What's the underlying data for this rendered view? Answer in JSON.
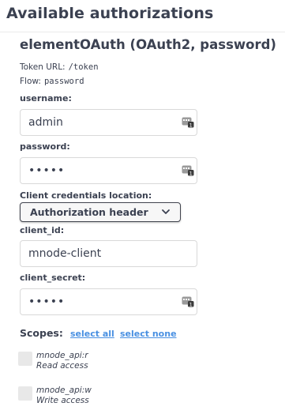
{
  "modal": {
    "title": "Available authorizations"
  },
  "auth": {
    "title": "elementOAuth (OAuth2, password)",
    "token_url_label": "Token URL:",
    "token_url_value": "/token",
    "flow_label": "Flow:",
    "flow_value": "password"
  },
  "fields": {
    "username": {
      "label": "username:",
      "value": "admin"
    },
    "password": {
      "label": "password:",
      "value": "•••••"
    },
    "client_credentials_location": {
      "label": "Client credentials location:",
      "selected": "Authorization header"
    },
    "client_id": {
      "label": "client_id:",
      "value": "mnode-client"
    },
    "client_secret": {
      "label": "client_secret:",
      "value": "•••••"
    }
  },
  "scopes": {
    "label": "Scopes:",
    "select_all": "select all",
    "select_none": "select none",
    "items": [
      {
        "name": "mnode_api:r",
        "description": "Read access"
      },
      {
        "name": "mnode_api:w",
        "description": "Write access"
      }
    ]
  },
  "colors": {
    "link": "#4990e2",
    "text": "#3b4151",
    "checkbox": "#e8e8e8"
  },
  "icons": {
    "password_manager": "key-icon",
    "select_arrow": "chevron-down-icon"
  }
}
